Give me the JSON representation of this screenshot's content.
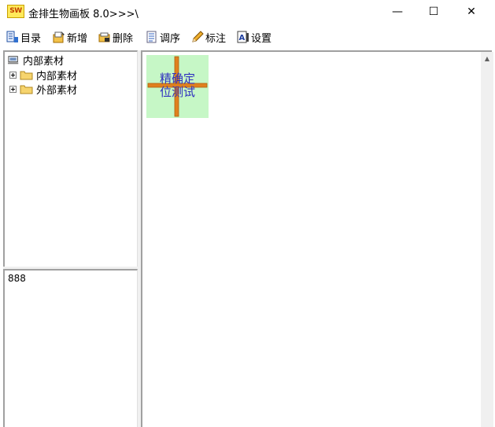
{
  "window": {
    "app_icon_text": "SW",
    "title": "金排生物画板 8.0>>>\\",
    "minimize": "—",
    "maximize": "☐",
    "close": "✕"
  },
  "toolbar": {
    "items": [
      {
        "label": "目录",
        "icon": "catalog-icon"
      },
      {
        "label": "新增",
        "icon": "add-icon"
      },
      {
        "label": "删除",
        "icon": "delete-icon"
      },
      {
        "label": "调序",
        "icon": "reorder-icon"
      },
      {
        "label": "标注",
        "icon": "annotate-pencil-icon"
      },
      {
        "label": "设置",
        "icon": "settings-icon"
      }
    ]
  },
  "tree": {
    "root": "内部素材",
    "children": [
      {
        "label": "内部素材"
      },
      {
        "label": "外部素材"
      }
    ]
  },
  "memo": {
    "text": "888"
  },
  "canvas": {
    "card_line1": "精确定",
    "card_line2": "位测试",
    "card_bg": "#c6f7c6",
    "cross_color": "#e0801e",
    "text_color": "#3030c0"
  }
}
